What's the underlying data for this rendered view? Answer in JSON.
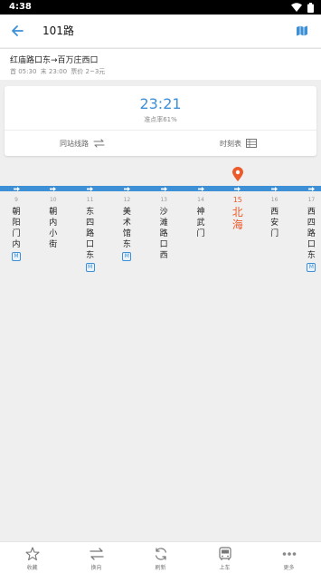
{
  "status_bar": {
    "time": "4:38"
  },
  "app_bar": {
    "title": "101路"
  },
  "route_info": {
    "direction": "红庙路口东→百万庄西口",
    "first_bus": "首 05:30",
    "last_bus": "末 23:00",
    "fare": "票价 2~3元"
  },
  "arrival": {
    "eta": "23:21",
    "on_time_rate": "准点率61%",
    "same_station_label": "同站线路",
    "timetable_label": "时刻表"
  },
  "colors": {
    "accent": "#3d8fd6",
    "current_stop": "#ec5a2a"
  },
  "stops": [
    {
      "num": "9",
      "name": "朝阳门内",
      "metro": true,
      "current": false
    },
    {
      "num": "10",
      "name": "朝内小街",
      "metro": false,
      "current": false
    },
    {
      "num": "11",
      "name": "东四路口东",
      "metro": true,
      "current": false
    },
    {
      "num": "12",
      "name": "美术馆东",
      "metro": true,
      "current": false
    },
    {
      "num": "13",
      "name": "沙滩路口西",
      "metro": false,
      "current": false
    },
    {
      "num": "14",
      "name": "神武门",
      "metro": false,
      "current": false
    },
    {
      "num": "15",
      "name": "北海",
      "metro": false,
      "current": true
    },
    {
      "num": "16",
      "name": "西安门",
      "metro": false,
      "current": false
    },
    {
      "num": "17",
      "name": "西四路口东",
      "metro": true,
      "current": false
    }
  ],
  "metro_badge": "M",
  "bottom_nav": [
    {
      "label": "收藏",
      "icon": "star-icon"
    },
    {
      "label": "换向",
      "icon": "swap-icon"
    },
    {
      "label": "刷新",
      "icon": "refresh-icon"
    },
    {
      "label": "上车",
      "icon": "bus-icon"
    },
    {
      "label": "更多",
      "icon": "more-icon"
    }
  ]
}
